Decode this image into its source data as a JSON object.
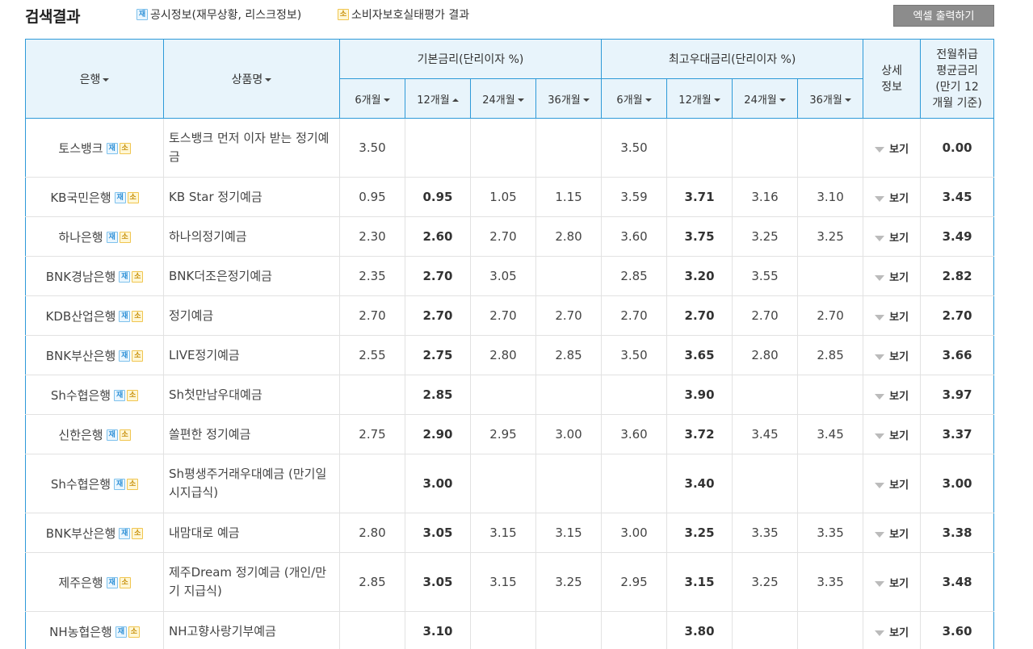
{
  "header": {
    "title": "검색결과",
    "legend": [
      {
        "badge": "재",
        "label": "공시정보(재무상황, 리스크정보)"
      },
      {
        "badge": "소",
        "label": "소비자보호실태평가 결과"
      }
    ],
    "excel_button": "엑셀 출력하기"
  },
  "table": {
    "col_bank": "은행",
    "col_product": "상품명",
    "group_base": "기본금리(단리이자 %)",
    "group_max": "최고우대금리(단리이자 %)",
    "col_detail": "상세\n정보",
    "col_avg": "전월취급\n평균금리\n(만기 12\n개월 기준)",
    "terms": [
      "6개월",
      "12개월",
      "24개월",
      "36개월"
    ],
    "badge_j": "재",
    "badge_s": "소",
    "detail_label": "보기",
    "rows": [
      {
        "bank": "토스뱅크",
        "product": "토스뱅크 먼저 이자 받는 정기예금",
        "base": [
          "3.50",
          "",
          "",
          ""
        ],
        "max": [
          "3.50",
          "",
          "",
          ""
        ],
        "avg": "0.00",
        "tall": true
      },
      {
        "bank": "KB국민은행",
        "product": "KB Star 정기예금",
        "base": [
          "0.95",
          "0.95",
          "1.05",
          "1.15"
        ],
        "max": [
          "3.59",
          "3.71",
          "3.16",
          "3.10"
        ],
        "avg": "3.45"
      },
      {
        "bank": "하나은행",
        "product": "하나의정기예금",
        "base": [
          "2.30",
          "2.60",
          "2.70",
          "2.80"
        ],
        "max": [
          "3.60",
          "3.75",
          "3.25",
          "3.25"
        ],
        "avg": "3.49"
      },
      {
        "bank": "BNK경남은행",
        "product": "BNK더조은정기예금",
        "base": [
          "2.35",
          "2.70",
          "3.05",
          ""
        ],
        "max": [
          "2.85",
          "3.20",
          "3.55",
          ""
        ],
        "avg": "2.82"
      },
      {
        "bank": "KDB산업은행",
        "product": "정기예금",
        "base": [
          "2.70",
          "2.70",
          "2.70",
          "2.70"
        ],
        "max": [
          "2.70",
          "2.70",
          "2.70",
          "2.70"
        ],
        "avg": "2.70"
      },
      {
        "bank": "BNK부산은행",
        "product": "LIVE정기예금",
        "base": [
          "2.55",
          "2.75",
          "2.80",
          "2.85"
        ],
        "max": [
          "3.50",
          "3.65",
          "2.80",
          "2.85"
        ],
        "avg": "3.66"
      },
      {
        "bank": "Sh수협은행",
        "product": "Sh첫만남우대예금",
        "base": [
          "",
          "2.85",
          "",
          ""
        ],
        "max": [
          "",
          "3.90",
          "",
          ""
        ],
        "avg": "3.97"
      },
      {
        "bank": "신한은행",
        "product": "쏠편한 정기예금",
        "base": [
          "2.75",
          "2.90",
          "2.95",
          "3.00"
        ],
        "max": [
          "3.60",
          "3.72",
          "3.45",
          "3.45"
        ],
        "avg": "3.37"
      },
      {
        "bank": "Sh수협은행",
        "product": "Sh평생주거래우대예금 (만기일시지급식)",
        "base": [
          "",
          "3.00",
          "",
          ""
        ],
        "max": [
          "",
          "3.40",
          "",
          ""
        ],
        "avg": "3.00",
        "tall": true
      },
      {
        "bank": "BNK부산은행",
        "product": "내맘대로 예금",
        "base": [
          "2.80",
          "3.05",
          "3.15",
          "3.15"
        ],
        "max": [
          "3.00",
          "3.25",
          "3.35",
          "3.35"
        ],
        "avg": "3.38"
      },
      {
        "bank": "제주은행",
        "product": "제주Dream 정기예금 (개인/만기 지급식)",
        "base": [
          "2.85",
          "3.05",
          "3.15",
          "3.25"
        ],
        "max": [
          "2.95",
          "3.15",
          "3.25",
          "3.35"
        ],
        "avg": "3.48",
        "tall": true
      },
      {
        "bank": "NH농협은행",
        "product": "NH고향사랑기부예금",
        "base": [
          "",
          "3.10",
          "",
          ""
        ],
        "max": [
          "",
          "3.80",
          "",
          ""
        ],
        "avg": "3.60"
      }
    ]
  },
  "colors": {
    "accent_border": "#2e9ad8",
    "header_bg": "#e8f4fb",
    "button_bg": "#8c8c8c"
  }
}
